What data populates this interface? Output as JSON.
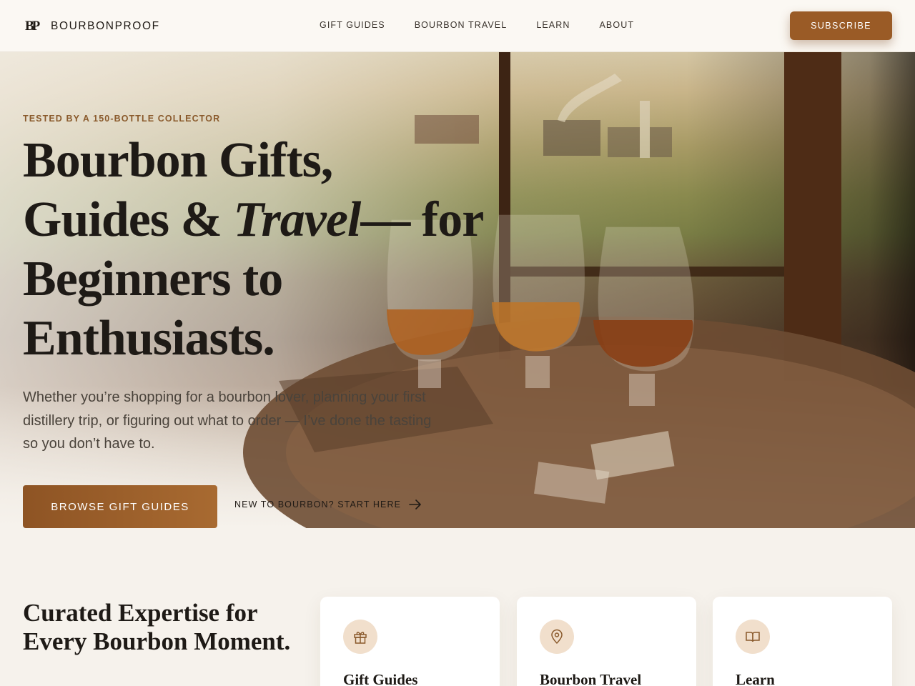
{
  "header": {
    "logo_mark": "BP",
    "logo_text": "BOURBONPROOF",
    "nav": [
      "GIFT GUIDES",
      "BOURBON TRAVEL",
      "LEARN",
      "ABOUT"
    ],
    "subscribe_label": "SUBSCRIBE"
  },
  "hero": {
    "eyebrow": "TESTED BY A 150-BOTTLE COLLECTOR",
    "headline_line1": "Bourbon Gifts,",
    "headline_line2a": "Guides & ",
    "headline_line2b": "Travel",
    "headline_line2c": "— for",
    "headline_line3": "Beginners to",
    "headline_line4": "Enthusiasts.",
    "subtext": "Whether you’re shopping for a bourbon lover, planning your first distillery trip, or figuring out what to order — I’ve done the tasting so you don’t have to.",
    "cta_primary": "BROWSE GIFT GUIDES",
    "cta_secondary": "NEW TO BOURBON? START HERE"
  },
  "section": {
    "title": "Curated Expertise for Every Bourbon Moment.",
    "cards": [
      {
        "title": "Gift Guides",
        "icon": "gift-icon"
      },
      {
        "title": "Bourbon Travel",
        "icon": "map-pin-icon"
      },
      {
        "title": "Learn",
        "icon": "book-icon"
      }
    ]
  },
  "colors": {
    "accent": "#9a5b26",
    "background": "#f6f2ec",
    "icon_bg": "#f1dfcc",
    "eyebrow": "#8a5a2c"
  }
}
